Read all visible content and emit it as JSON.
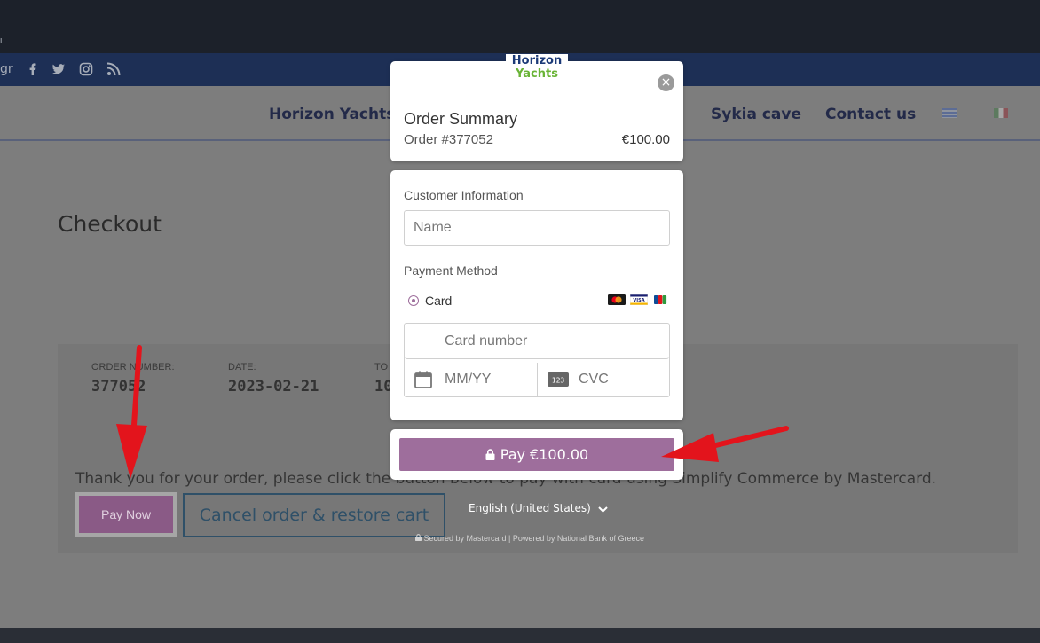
{
  "topbar": {
    "mark": "ι"
  },
  "socialbar": {
    "text": "gr",
    "icons": [
      "facebook-icon",
      "twitter-icon",
      "instagram-icon",
      "rss-icon"
    ]
  },
  "nav": {
    "items": [
      "Horizon Yachts",
      "Sykia cave",
      "Contact us"
    ],
    "flags": [
      "greek-flag-icon",
      "italian-flag-icon"
    ]
  },
  "page": {
    "title": "Checkout",
    "order_meta": [
      {
        "label": "ORDER NUMBER:",
        "value": "377052"
      },
      {
        "label": "DATE:",
        "value": "2023-02-21"
      },
      {
        "label": "TO",
        "value": "10"
      }
    ],
    "thank_text": "Thank you for your order, please click the button below to pay with card using Simplify Commerce by Mastercard.",
    "pay_now_label": "Pay Now",
    "cancel_label": "Cancel order & restore cart"
  },
  "modal": {
    "logo": {
      "line1": "Horizon",
      "line2": "Yachts"
    },
    "close_symbol": "×",
    "summary_title": "Order Summary",
    "order_number": "Order #377052",
    "amount": "€100.00",
    "customer_info_label": "Customer Information",
    "name_placeholder": "Name",
    "payment_method_label": "Payment Method",
    "card_option_label": "Card",
    "card_brands": [
      "mastercard-icon",
      "visa-icon",
      "jcb-icon"
    ],
    "card_number_placeholder": "Card number",
    "expiry_placeholder": "MM/YY",
    "cvc_placeholder": "CVC",
    "pay_button_label": "Pay €100.00",
    "language": "English (United States)",
    "secured_text": "Secured by Mastercard | Powered by National Bank of Greece"
  },
  "colors": {
    "accent": "#9e6e9c",
    "logo_blue": "#1c3a78",
    "logo_green": "#6ab437",
    "annotation_red": "#e3141c"
  }
}
